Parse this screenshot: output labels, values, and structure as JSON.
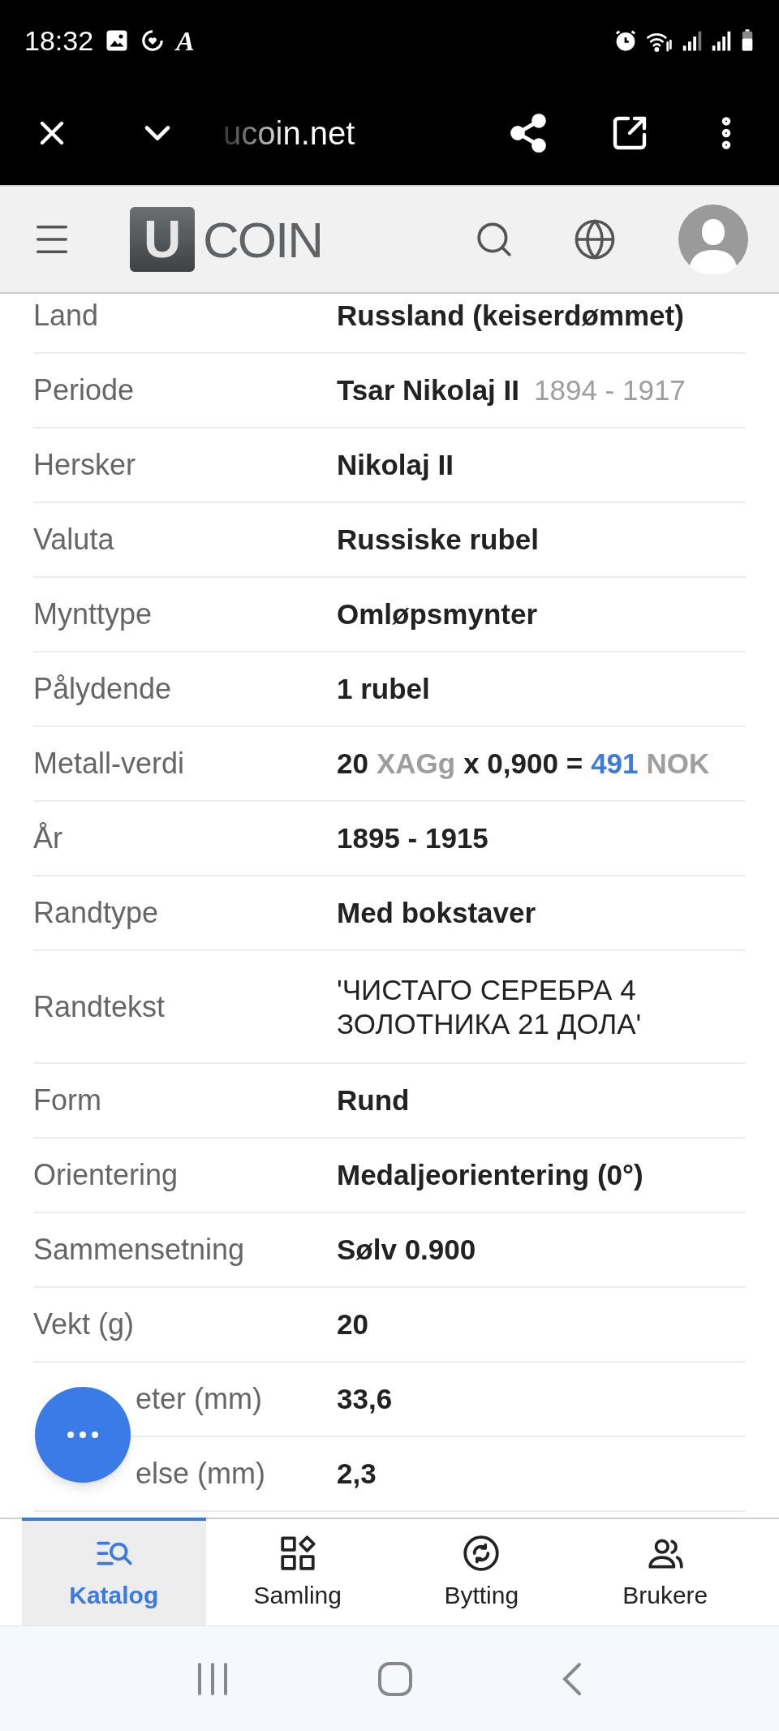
{
  "status_bar": {
    "time": "18:32",
    "notification_glyph": "A"
  },
  "browser": {
    "url": "ucoin.net"
  },
  "site_header": {
    "logo_letter": "U",
    "logo_text": "COIN"
  },
  "details": [
    {
      "label": "Land",
      "value": [
        {
          "kind": "main",
          "text": "Russland (keiserdømmet)"
        }
      ]
    },
    {
      "label": "Periode",
      "value": [
        {
          "kind": "main",
          "text": "Tsar Nikolaj II"
        },
        {
          "kind": "muted",
          "text": "1894 - 1917"
        }
      ]
    },
    {
      "label": "Hersker",
      "value": [
        {
          "kind": "main",
          "text": "Nikolaj II"
        }
      ]
    },
    {
      "label": "Valuta",
      "value": [
        {
          "kind": "main",
          "text": "Russiske rubel"
        }
      ]
    },
    {
      "label": "Mynttype",
      "value": [
        {
          "kind": "main",
          "text": "Omløpsmynter"
        }
      ]
    },
    {
      "label": "Pålydende",
      "value": [
        {
          "kind": "main",
          "text": "1 rubel"
        }
      ]
    },
    {
      "label": "Metall-verdi",
      "value": [
        {
          "kind": "main",
          "text": "20"
        },
        {
          "kind": "muted",
          "text": "XAGg"
        },
        {
          "kind": "main",
          "text": "x 0,900 ="
        },
        {
          "kind": "link",
          "text": "491"
        },
        {
          "kind": "muted",
          "text": "NOK"
        }
      ]
    },
    {
      "label": "År",
      "value": [
        {
          "kind": "main",
          "text": "1895 - 1915"
        }
      ]
    },
    {
      "label": "Randtype",
      "value": [
        {
          "kind": "main",
          "text": "Med bokstaver"
        }
      ]
    },
    {
      "label": "Randtekst",
      "value": [
        {
          "kind": "plain",
          "text": "'ЧИСТАГО СЕРЕБРА 4 ЗОЛОТНИКА 21 ДОЛА'"
        }
      ]
    },
    {
      "label": "Form",
      "value": [
        {
          "kind": "main",
          "text": "Rund"
        }
      ]
    },
    {
      "label": "Orientering",
      "value": [
        {
          "kind": "main",
          "text": "Medaljeorientering (0°)"
        }
      ]
    },
    {
      "label": "Sammensetning",
      "value": [
        {
          "kind": "main",
          "text": "Sølv 0.900"
        }
      ]
    },
    {
      "label": "Vekt (g)",
      "value": [
        {
          "kind": "main",
          "text": "20"
        }
      ]
    },
    {
      "label": "eter (mm)",
      "behind_button": true,
      "value": [
        {
          "kind": "main",
          "text": "33,6"
        }
      ]
    },
    {
      "label": "else (mm)",
      "behind_button": true,
      "value": [
        {
          "kind": "main",
          "text": "2,3"
        }
      ]
    }
  ],
  "bottom_nav": [
    {
      "label": "Katalog",
      "selected": true
    },
    {
      "label": "Samling",
      "selected": false
    },
    {
      "label": "Bytting",
      "selected": false
    },
    {
      "label": "Brukere",
      "selected": false
    }
  ]
}
